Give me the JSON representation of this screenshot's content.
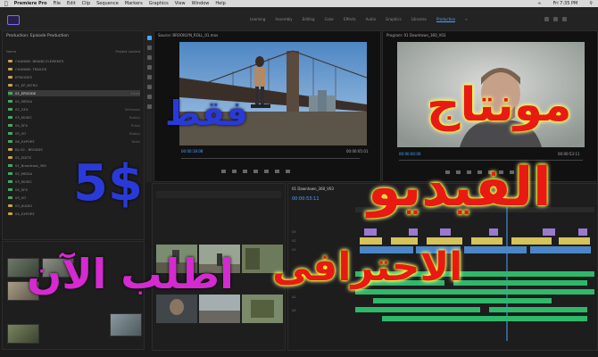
{
  "menubar": {
    "app_name": "Premiere Pro",
    "items": [
      "File",
      "Edit",
      "Clip",
      "Sequence",
      "Markers",
      "Graphics",
      "View",
      "Window",
      "Help"
    ],
    "clock": "Fri 7:35 PM"
  },
  "workspaces": {
    "tabs": [
      "Learning",
      "Assembly",
      "Editing",
      "Color",
      "Effects",
      "Audio",
      "Graphics",
      "Libraries",
      "Production",
      "»"
    ]
  },
  "project_panel": {
    "title": "Production: Episode Production",
    "columns": [
      "Name",
      "Project Locked"
    ],
    "rows": [
      {
        "kind": "folder",
        "label": "CHANNEL BRAND ELEMENTS",
        "tag": ""
      },
      {
        "kind": "folder",
        "label": "CHANNEL TRAILER",
        "tag": ""
      },
      {
        "kind": "folder",
        "label": "EPISODES",
        "tag": ""
      },
      {
        "kind": "folder",
        "label": "01_EP_INTRO",
        "tag": ""
      },
      {
        "kind": "clip",
        "label": "01_EPISODE",
        "tag": "Sizzle",
        "selected": true
      },
      {
        "kind": "clip",
        "label": "02_MEDIA",
        "tag": ""
      },
      {
        "kind": "clip",
        "label": "02_GFX",
        "tag": "Windows"
      },
      {
        "kind": "clip",
        "label": "03_MUSIC",
        "tag": "Bobby"
      },
      {
        "kind": "clip",
        "label": "04_SFX",
        "tag": "Press"
      },
      {
        "kind": "clip",
        "label": "05_VO",
        "tag": "Bobby"
      },
      {
        "kind": "clip",
        "label": "06_EXPORT",
        "tag": "Taste"
      },
      {
        "kind": "folder",
        "label": "Ep 02 - BROADS",
        "tag": ""
      },
      {
        "kind": "folder",
        "label": "02_EDITS",
        "tag": ""
      },
      {
        "kind": "clip",
        "label": "01_Broadcast_360",
        "tag": ""
      },
      {
        "kind": "clip",
        "label": "02_MEDIA",
        "tag": ""
      },
      {
        "kind": "clip",
        "label": "03_MUSIC",
        "tag": ""
      },
      {
        "kind": "clip",
        "label": "04_SFX",
        "tag": ""
      },
      {
        "kind": "clip",
        "label": "05_VO",
        "tag": ""
      },
      {
        "kind": "folder",
        "label": "03_AUDIO",
        "tag": ""
      },
      {
        "kind": "folder",
        "label": "04_EXPORT",
        "tag": ""
      }
    ]
  },
  "source_monitor": {
    "title": "Source: BROOKLYN_ROLL_01.mov",
    "timecode": "00:00:18:08",
    "duration": "00:00:05:01"
  },
  "program_monitor": {
    "title": "Program: 01 Downtown_360_V03",
    "timecode": "00:00:00:00",
    "duration": "00:00:53:11"
  },
  "timeline": {
    "title": "01 Downtown_360_V03",
    "timecode": "00:00:53:11",
    "tracks": [
      "V3",
      "V2",
      "V1",
      "A1",
      "A2",
      "A3"
    ]
  },
  "promo": {
    "only": "فقط",
    "price": "5$",
    "order_now": "اطلب الآن",
    "montage": "مونتاج",
    "video": "الفيديو",
    "professional": "الاحترافى"
  },
  "colors": {
    "accent_blue": "#4aa3ff",
    "promo_blue": "#2a3ad8",
    "promo_magenta": "#d42ad0",
    "promo_red": "#e81a12",
    "glow_yellow": "#ffff00"
  }
}
